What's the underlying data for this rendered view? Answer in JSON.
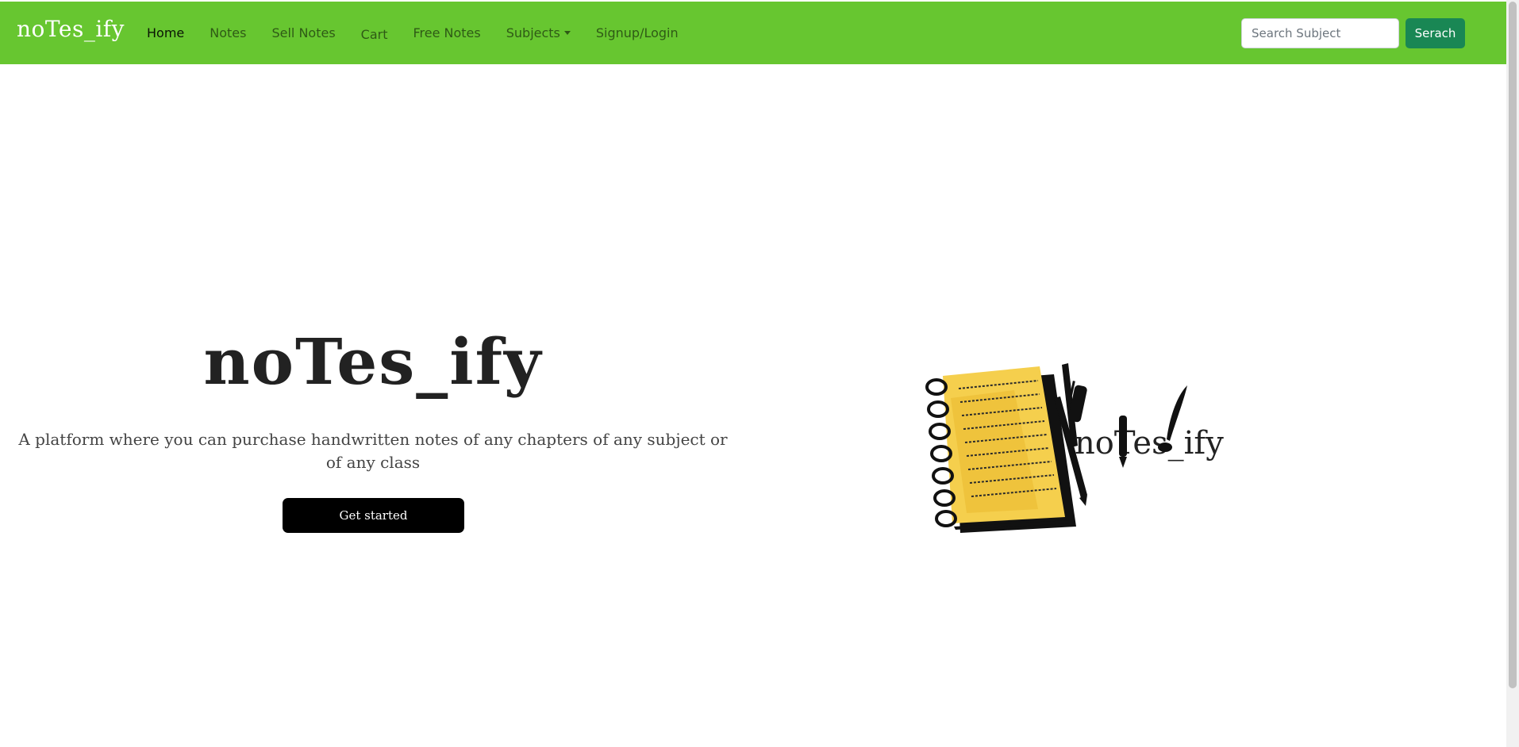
{
  "navbar": {
    "brand": "noTes_ify",
    "links": [
      {
        "label": "Home"
      },
      {
        "label": "Notes"
      },
      {
        "label": "Sell Notes"
      },
      {
        "label": "Cart"
      },
      {
        "label": "Free Notes"
      },
      {
        "label": "Subjects"
      },
      {
        "label": "Signup/Login"
      }
    ],
    "search": {
      "placeholder": "Search Subject",
      "value": "",
      "button_label": "Serach"
    },
    "color": "#67c630"
  },
  "hero": {
    "title": "noTes_ify",
    "subtitle": "A platform where you can purchase handwritten notes of any chapters of any subject or of any class",
    "cta_label": "Get started",
    "logo_text": "noTes_ify"
  }
}
